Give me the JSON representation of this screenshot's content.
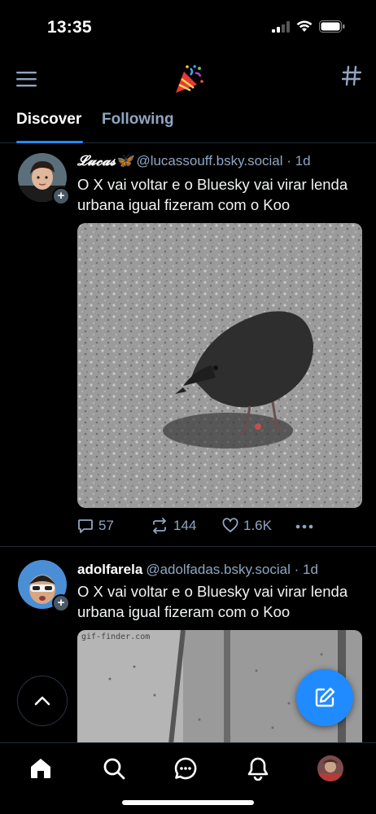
{
  "status": {
    "time": "13:35"
  },
  "nav": {
    "tabs": [
      {
        "label": "Discover"
      },
      {
        "label": "Following"
      }
    ]
  },
  "posts": [
    {
      "display_name": "𝓛𝓾𝓬𝓪𝓼🦋",
      "handle": "@lucassouff.bsky.social",
      "time": " · 1d",
      "text": "O X vai voltar e o Bluesky vai virar lenda urbana igual fizeram com o Koo",
      "replies": "57",
      "reposts": "144",
      "likes": "1.6K"
    },
    {
      "display_name": "adolfarela",
      "handle": "@adolfadas.bsky.social",
      "time": " · 1d",
      "text": "O X vai voltar e o Bluesky vai virar lenda urbana igual fizeram com o Koo",
      "media_watermark": "gif-finder.com"
    }
  ],
  "colors": {
    "accent": "#208bfe",
    "muted": "#8ea6c2",
    "background": "#000000",
    "divider": "#1f2a36"
  },
  "icons": [
    "menu-icon",
    "party-popper-icon",
    "hashtag-icon",
    "reply-icon",
    "repost-icon",
    "like-icon",
    "more-icon",
    "chevron-up-icon",
    "compose-icon",
    "home-icon",
    "search-icon",
    "chat-icon",
    "bell-icon"
  ]
}
